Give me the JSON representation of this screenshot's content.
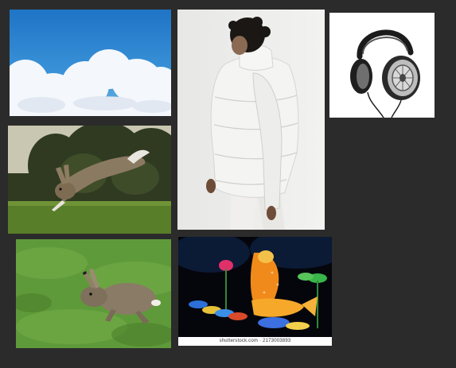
{
  "watermark": {
    "lantern_credit": "shutterstock.com · 2173003893"
  },
  "images": [
    {
      "name": "sky-clouds-image"
    },
    {
      "name": "white-puffer-jacket-image"
    },
    {
      "name": "headphones-image"
    },
    {
      "name": "leaping-hare-image"
    },
    {
      "name": "running-hare-image"
    },
    {
      "name": "fish-lantern-image"
    }
  ]
}
